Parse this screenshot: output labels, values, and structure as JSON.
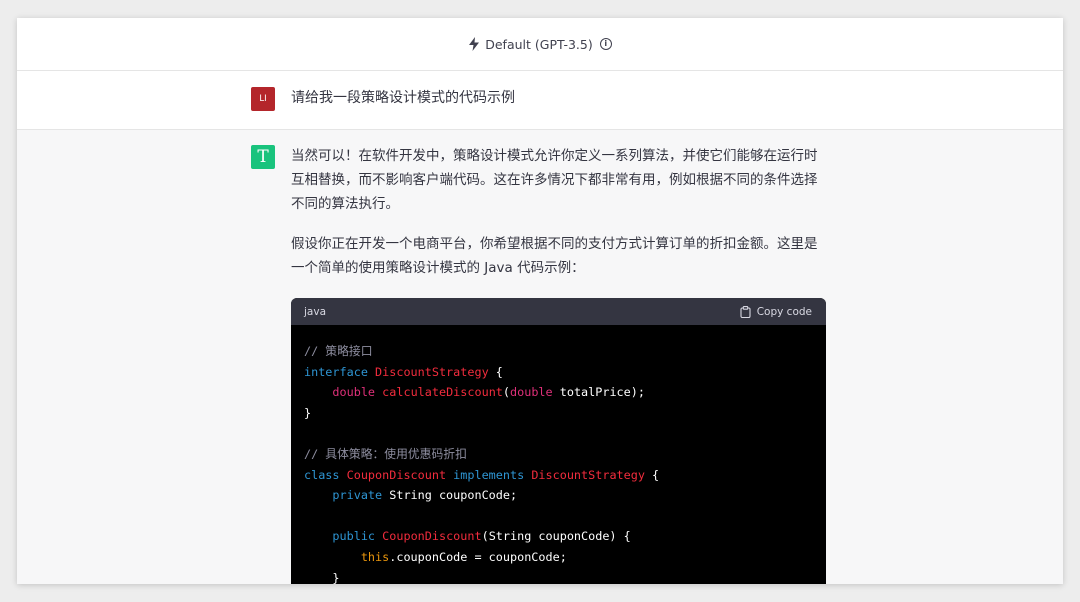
{
  "header": {
    "model_label": "Default (GPT-3.5)",
    "info_glyph": "i",
    "icons": [
      "bolt-icon",
      "info-icon"
    ]
  },
  "user_message": {
    "avatar_initials": "LI",
    "avatar_color": "#b4262b",
    "text": "请给我一段策略设计模式的代码示例"
  },
  "assistant_message": {
    "avatar_glyph": "T",
    "avatar_color": "#19c37d",
    "paragraphs": [
      "当然可以！在软件开发中，策略设计模式允许你定义一系列算法，并使它们能够在运行时互相替换，而不影响客户端代码。这在许多情况下都非常有用，例如根据不同的条件选择不同的算法执行。",
      "假设你正在开发一个电商平台，你希望根据不同的支付方式计算订单的折扣金额。这里是一个简单的使用策略设计模式的 Java 代码示例："
    ],
    "code_block": {
      "language": "java",
      "copy_label": "Copy code",
      "lines": [
        [
          {
            "t": "// 策略接口",
            "c": "com"
          }
        ],
        [
          {
            "t": "interface ",
            "c": "kw"
          },
          {
            "t": "DiscountStrategy",
            "c": "fn"
          },
          {
            "t": " {",
            "c": "plain"
          }
        ],
        [
          {
            "t": "    ",
            "c": "plain"
          },
          {
            "t": "double",
            "c": "type"
          },
          {
            "t": " ",
            "c": "plain"
          },
          {
            "t": "calculateDiscount",
            "c": "fn"
          },
          {
            "t": "(",
            "c": "plain"
          },
          {
            "t": "double",
            "c": "type"
          },
          {
            "t": " totalPrice);",
            "c": "plain"
          }
        ],
        [
          {
            "t": "}",
            "c": "plain"
          }
        ],
        [],
        [
          {
            "t": "// 具体策略：使用优惠码折扣",
            "c": "com"
          }
        ],
        [
          {
            "t": "class ",
            "c": "kw"
          },
          {
            "t": "CouponDiscount",
            "c": "fn"
          },
          {
            "t": " ",
            "c": "plain"
          },
          {
            "t": "implements",
            "c": "kw"
          },
          {
            "t": " ",
            "c": "plain"
          },
          {
            "t": "DiscountStrategy",
            "c": "fn"
          },
          {
            "t": " {",
            "c": "plain"
          }
        ],
        [
          {
            "t": "    ",
            "c": "plain"
          },
          {
            "t": "private",
            "c": "kw"
          },
          {
            "t": " String couponCode;",
            "c": "plain"
          }
        ],
        [],
        [
          {
            "t": "    ",
            "c": "plain"
          },
          {
            "t": "public",
            "c": "kw"
          },
          {
            "t": " ",
            "c": "plain"
          },
          {
            "t": "CouponDiscount",
            "c": "fn"
          },
          {
            "t": "(String couponCode) {",
            "c": "plain"
          }
        ],
        [
          {
            "t": "        ",
            "c": "plain"
          },
          {
            "t": "this",
            "c": "this"
          },
          {
            "t": ".couponCode = couponCode;",
            "c": "plain"
          }
        ],
        [
          {
            "t": "    }",
            "c": "plain"
          }
        ]
      ]
    }
  }
}
